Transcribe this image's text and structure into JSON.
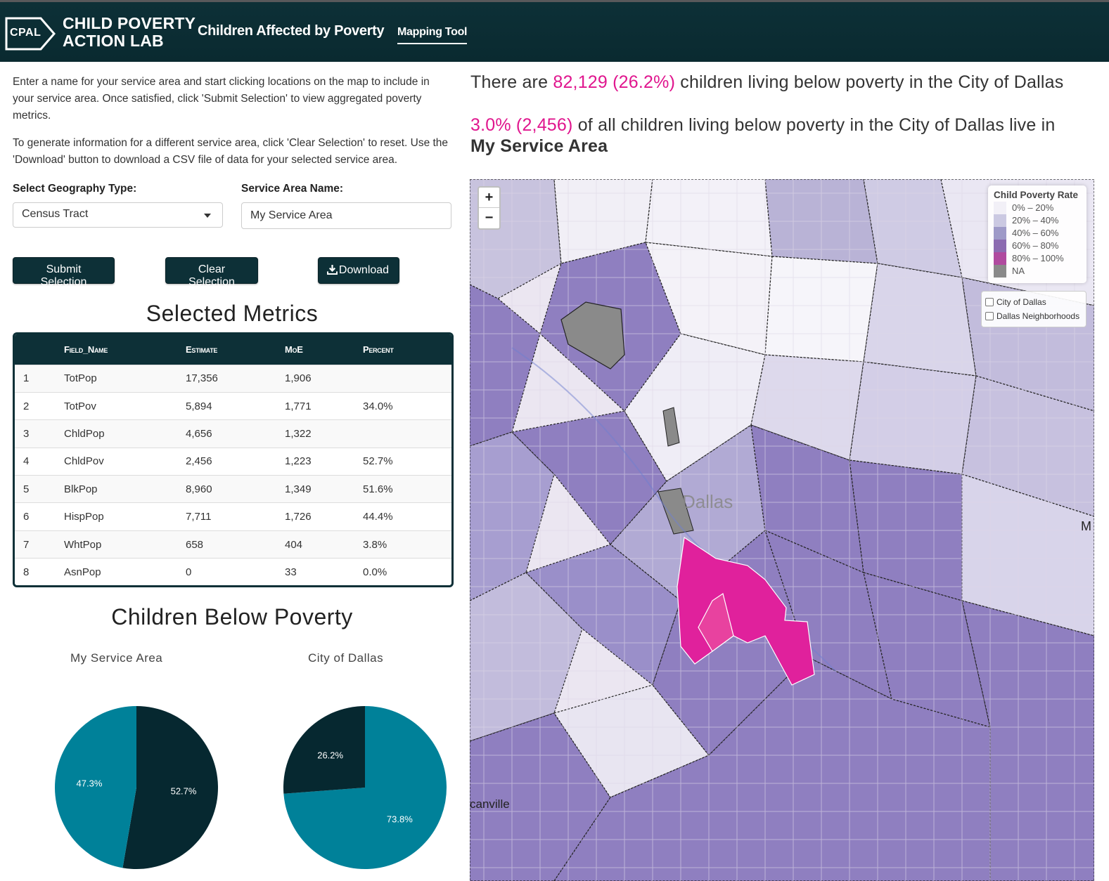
{
  "header": {
    "logo_text": "CPAL",
    "org_line1": "CHILD POVERTY",
    "org_line2": "ACTION LAB",
    "app_title": "Children Affected by Poverty",
    "nav_tab": "Mapping Tool"
  },
  "intro": {
    "p1": "Enter a name for your service area and start clicking locations on the map to include in your service area. Once satisfied, click 'Submit Selection' to view aggregated poverty metrics.",
    "p2": "To generate information for a different service area, click 'Clear Selection' to reset. Use the 'Download' button to download a CSV file of data for your selected service area."
  },
  "controls": {
    "geo_label": "Select Geography Type:",
    "geo_value": "Census Tract",
    "name_label": "Service Area Name:",
    "name_value": "My Service Area",
    "submit": "Submit Selection",
    "clear": "Clear Selection",
    "download": "Download"
  },
  "metrics": {
    "title": "Selected Metrics",
    "headers": [
      "",
      "Field_Name",
      "Estimate",
      "MoE",
      "Percent"
    ],
    "rows": [
      [
        "1",
        "TotPop",
        "17,356",
        "1,906",
        ""
      ],
      [
        "2",
        "TotPov",
        "5,894",
        "1,771",
        "34.0%"
      ],
      [
        "3",
        "ChldPop",
        "4,656",
        "1,322",
        ""
      ],
      [
        "4",
        "ChldPov",
        "2,456",
        "1,223",
        "52.7%"
      ],
      [
        "5",
        "BlkPop",
        "8,960",
        "1,349",
        "51.6%"
      ],
      [
        "6",
        "HispPop",
        "7,711",
        "1,726",
        "44.4%"
      ],
      [
        "7",
        "WhtPop",
        "658",
        "404",
        "3.8%"
      ],
      [
        "8",
        "AsnPop",
        "0",
        "33",
        "0.0%"
      ]
    ]
  },
  "pies": {
    "title": "Children Below Poverty",
    "left_title": "My Service Area",
    "right_title": "City of Dallas",
    "left_slices": [
      52.7,
      47.3
    ],
    "right_slices": [
      73.8,
      26.2
    ],
    "left_labels": [
      "52.7%",
      "47.3%"
    ],
    "right_labels": [
      "73.8%",
      "26.2%"
    ],
    "colors": {
      "dark": "#062830",
      "teal": "#008199"
    }
  },
  "stats": {
    "s1_pre": "There are ",
    "s1_num": "82,129 (26.2%)",
    "s1_post": " children living below poverty in the City of Dallas",
    "s2_num": "3.0% (2,456)",
    "s2_post": " of all children living below poverty in the City of Dallas live in",
    "s2_area": "My Service Area"
  },
  "map": {
    "zoom_in": "+",
    "zoom_out": "−",
    "city_label": "Dallas",
    "edge_label_left": "canville",
    "edge_label_right": "M",
    "legend_title": "Child Poverty Rate",
    "legend": [
      {
        "label": "0% – 20%",
        "color": "#f2f0f7"
      },
      {
        "label": "20% – 40%",
        "color": "#cbc9e2"
      },
      {
        "label": "40% – 60%",
        "color": "#9e9ac8"
      },
      {
        "label": "60% – 80%",
        "color": "#8c6bb1"
      },
      {
        "label": "80% – 100%",
        "color": "#b04a9f"
      },
      {
        "label": "NA",
        "color": "#8a8a8a"
      }
    ],
    "layers": [
      "City of Dallas",
      "Dallas Neighborhoods"
    ],
    "selection_color": "#e0219c"
  }
}
